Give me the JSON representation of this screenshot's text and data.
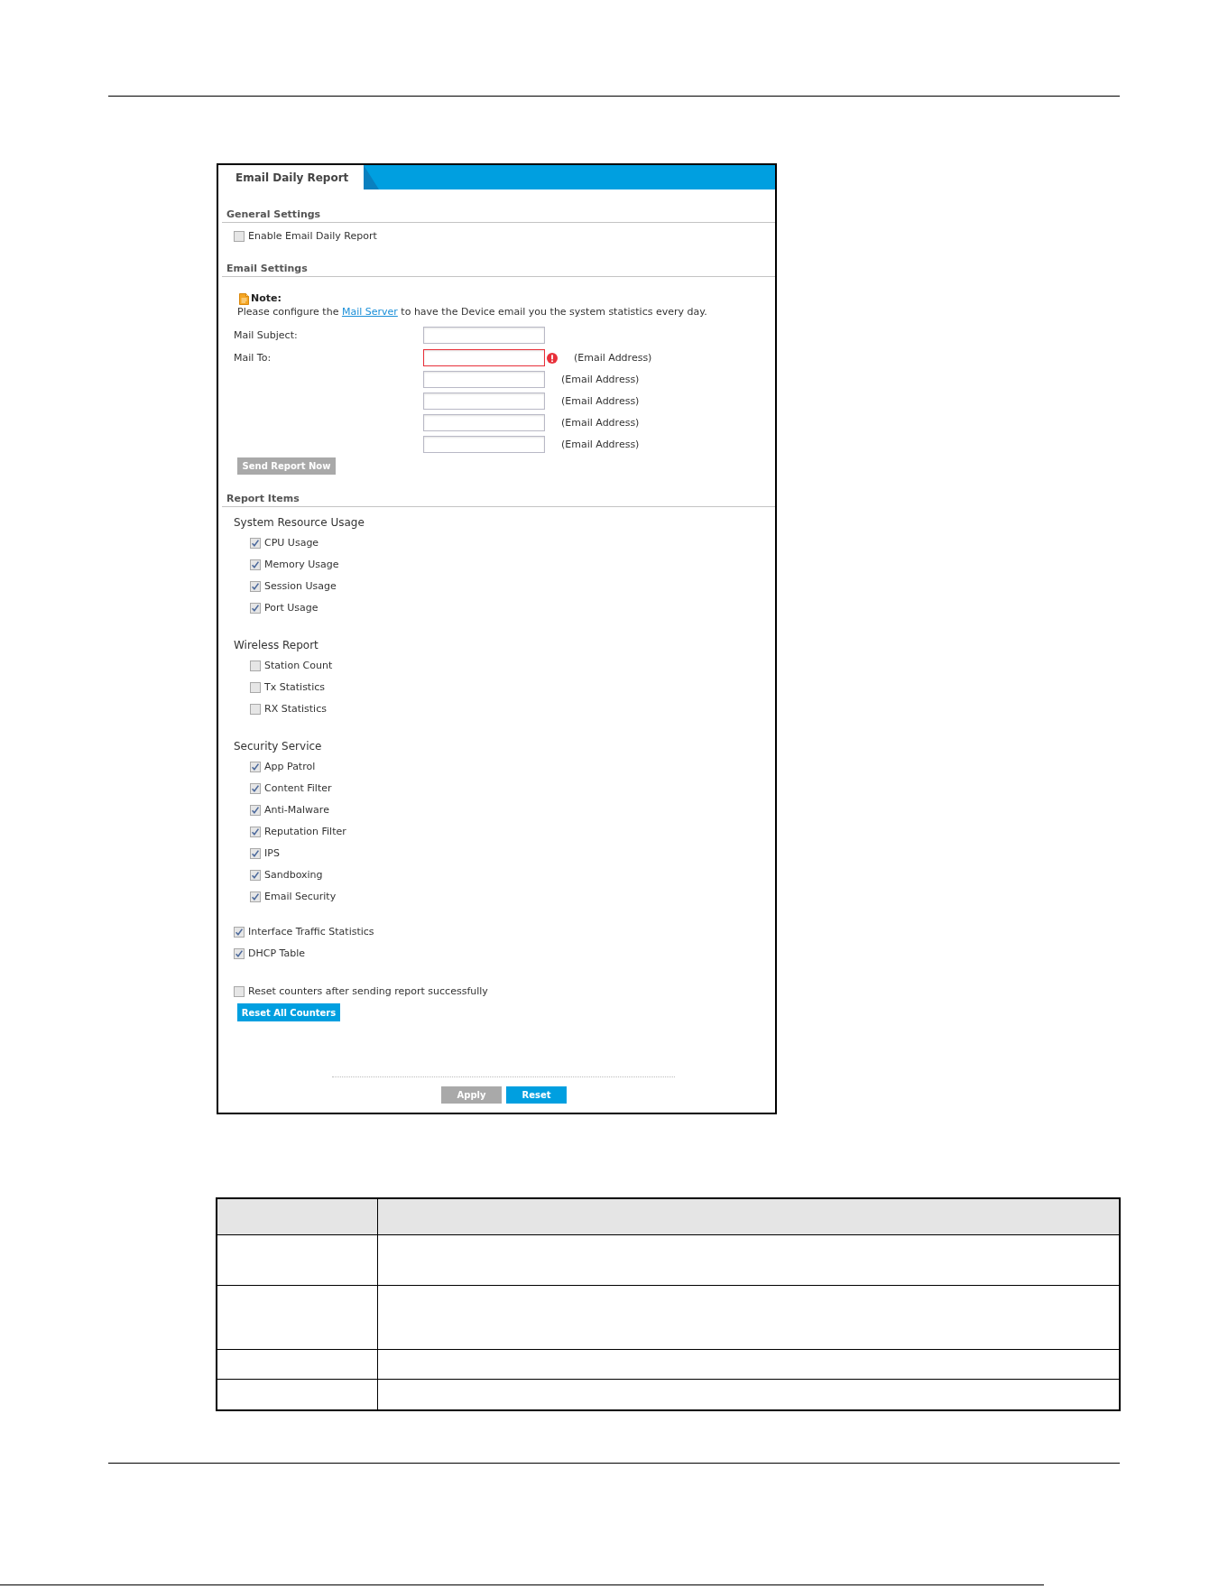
{
  "tab": {
    "label": "Email Daily Report",
    "selected": true
  },
  "general_settings": {
    "title": "General Settings",
    "enable_report": {
      "label": "Enable Email Daily Report",
      "checked": false
    }
  },
  "email_settings": {
    "title": "Email Settings",
    "note": {
      "title": "Note:",
      "text_before": "Please configure the ",
      "link": "Mail Server",
      "text_after": " to have the Device email you the system statistics every day."
    },
    "mail_subject": {
      "label": "Mail Subject:"
    },
    "mail_to": {
      "label": "Mail To:",
      "addresses": [
        {
          "suffix": "(Email Address)",
          "invalid": true
        },
        {
          "suffix": "(Email Address)",
          "invalid": false
        },
        {
          "suffix": "(Email Address)",
          "invalid": false
        },
        {
          "suffix": "(Email Address)",
          "invalid": false
        },
        {
          "suffix": "(Email Address)",
          "invalid": false
        }
      ]
    },
    "send_button": {
      "label": "Send Report Now",
      "disabled": true
    }
  },
  "report_items": {
    "title": "Report Items",
    "groups": [
      {
        "title": "System Resource Usage",
        "items": [
          {
            "label": "CPU Usage",
            "checked": true
          },
          {
            "label": "Memory Usage",
            "checked": true
          },
          {
            "label": "Session Usage",
            "checked": true
          },
          {
            "label": "Port Usage",
            "checked": true
          }
        ]
      },
      {
        "title": "Wireless Report",
        "items": [
          {
            "label": "Station Count",
            "checked": false
          },
          {
            "label": "Tx Statistics",
            "checked": false
          },
          {
            "label": "RX Statistics",
            "checked": false
          }
        ]
      },
      {
        "title": "Security Service",
        "items": [
          {
            "label": "App Patrol",
            "checked": true
          },
          {
            "label": "Content Filter",
            "checked": true
          },
          {
            "label": "Anti-Malware",
            "checked": true
          },
          {
            "label": "Reputation Filter",
            "checked": true
          },
          {
            "label": "IPS",
            "checked": true
          },
          {
            "label": "Sandboxing",
            "checked": true
          },
          {
            "label": "Email Security",
            "checked": true
          }
        ]
      }
    ],
    "options": [
      {
        "label": "Interface Traffic Statistics",
        "checked": true
      },
      {
        "label": "DHCP Table",
        "checked": true
      }
    ],
    "reset_counters": {
      "label": "Reset counters after sending report successfully",
      "checked": false
    },
    "reset_all_button": {
      "label": "Reset All Counters",
      "disabled": false
    }
  },
  "footer_buttons": [
    {
      "label": "Apply",
      "disabled": true
    },
    {
      "label": "Reset",
      "disabled": false
    }
  ]
}
